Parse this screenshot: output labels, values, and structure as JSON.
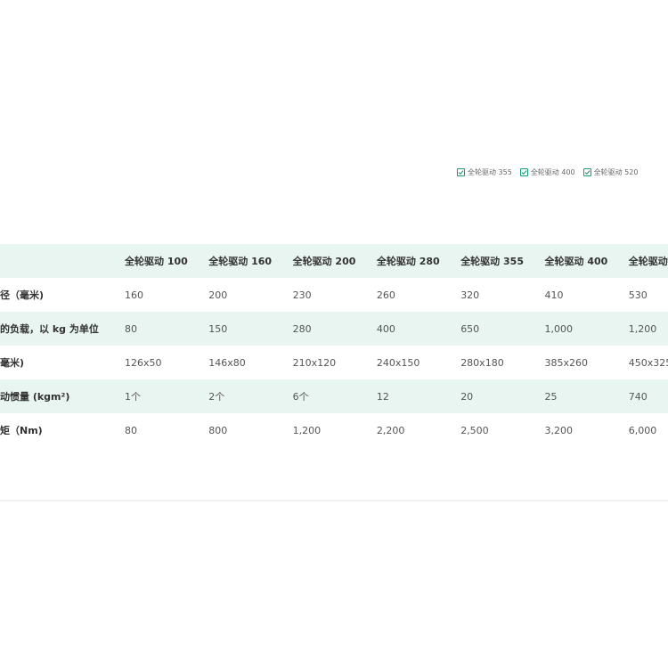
{
  "filters": [
    {
      "label": "全轮驱动 355",
      "checked": true
    },
    {
      "label": "全轮驱动 400",
      "checked": true
    },
    {
      "label": "全轮驱动 520",
      "checked": true
    }
  ],
  "table": {
    "columns": [
      "全轮驱动 100",
      "全轮驱动 160",
      "全轮驱动 200",
      "全轮驱动 280",
      "全轮驱动 355",
      "全轮驱动 400",
      "全轮驱动 5"
    ],
    "rows": [
      {
        "label": "径（毫米)",
        "values": [
          "160",
          "200",
          "230",
          "260",
          "320",
          "410",
          "530"
        ]
      },
      {
        "label": "的负载，以 kg 为单位",
        "values": [
          "80",
          "150",
          "280",
          "400",
          "650",
          "1,000",
          "1,200"
        ]
      },
      {
        "label": "毫米)",
        "values": [
          "126x50",
          "146x80",
          "210x120",
          "240x150",
          "280x180",
          "385x260",
          "450x325"
        ]
      },
      {
        "label": "动惯量 (kgm²)",
        "values": [
          "1个",
          "2个",
          "6个",
          "12",
          "20",
          "25",
          "740"
        ]
      },
      {
        "label": "矩（Nm)",
        "values": [
          "80",
          "800",
          "1,200",
          "2,200",
          "2,500",
          "3,200",
          "6,000"
        ]
      }
    ]
  },
  "colors": {
    "accent": "#1a9b78",
    "row_tint": "#e8f5f1"
  }
}
